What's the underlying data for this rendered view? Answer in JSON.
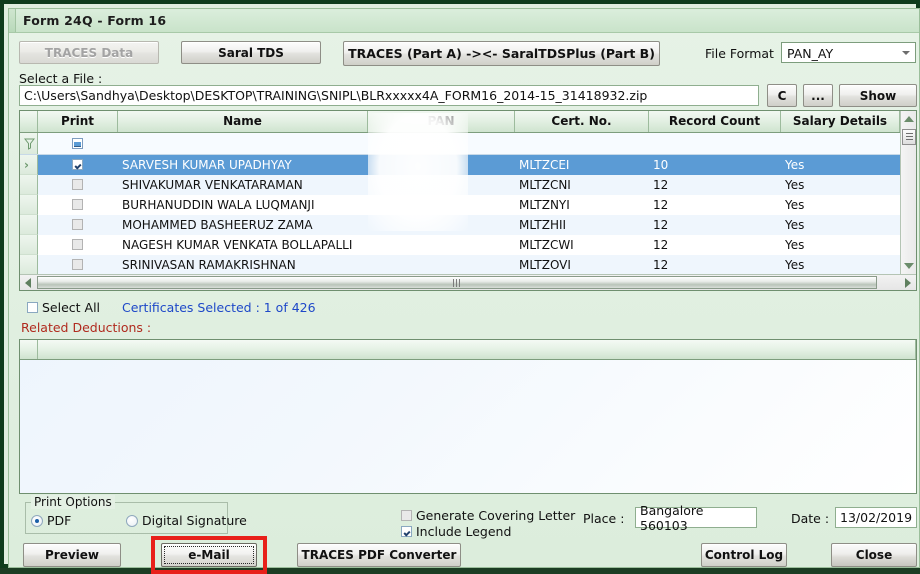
{
  "window": {
    "title": "Form 24Q - Form 16",
    "border_color": "#0e3c1c",
    "background_color": "#dfeedf"
  },
  "toolbar": {
    "traces_data_label": "TRACES Data",
    "saral_tds_label": "Saral TDS",
    "part_ab_label": "TRACES (Part A) -><- SaralTDSPlus (Part B)",
    "file_format_label": "File Format",
    "file_format_value": "PAN_AY",
    "file_format_options": [
      "PAN_AY"
    ]
  },
  "file_row": {
    "select_file_label": "Select a File :",
    "file_path": "C:\\Users\\Sandhya\\Desktop\\DESKTOP\\TRAINING\\SNIPL\\BLRxxxxx4A_FORM16_2014-15_31418932.zip",
    "c_button_label": "C",
    "browse_button_label": "...",
    "show_button_label": "Show"
  },
  "grid": {
    "columns": [
      "Print",
      "Name",
      "PAN",
      "Cert. No.",
      "Record Count",
      "Salary Details"
    ],
    "rows": [
      {
        "print_checked": true,
        "name": "SARVESH KUMAR UPADHYAY",
        "pan": "",
        "cert_no": "MLTZCEI",
        "record_count": "10",
        "salary_details": "Yes",
        "selected": true
      },
      {
        "print_checked": false,
        "name": "SHIVAKUMAR VENKATARAMAN",
        "pan": "",
        "cert_no": "MLTZCNI",
        "record_count": "12",
        "salary_details": "Yes",
        "selected": false
      },
      {
        "print_checked": false,
        "name": "BURHANUDDIN WALA LUQMANJI",
        "pan": "",
        "cert_no": "MLTZNYI",
        "record_count": "12",
        "salary_details": "Yes",
        "selected": false
      },
      {
        "print_checked": false,
        "name": "MOHAMMED BASHEERUZ ZAMA",
        "pan": "",
        "cert_no": "MLTZHII",
        "record_count": "12",
        "salary_details": "Yes",
        "selected": false
      },
      {
        "print_checked": false,
        "name": "NAGESH KUMAR VENKATA BOLLAPALLI",
        "pan": "",
        "cert_no": "MLTZCWI",
        "record_count": "12",
        "salary_details": "Yes",
        "selected": false
      },
      {
        "print_checked": false,
        "name": "SRINIVASAN RAMAKRISHNAN",
        "pan": "",
        "cert_no": "MLTZOVI",
        "record_count": "12",
        "salary_details": "Yes",
        "selected": false
      }
    ],
    "selection_highlight_color": "#5b9bd5"
  },
  "selection": {
    "select_all_label": "Select All",
    "select_all_checked": false,
    "certificates_selected_text": "Certificates Selected :  1 of 426",
    "certificates_selected_color": "#1e48c8"
  },
  "related": {
    "label": "Related Deductions :",
    "label_color": "#b02a1e",
    "rows": []
  },
  "print_options": {
    "group_title": "Print Options",
    "pdf_label": "PDF",
    "pdf_selected": true,
    "digital_signature_label": "Digital Signature",
    "digital_signature_selected": false
  },
  "options": {
    "generate_covering_letter_label": "Generate Covering Letter",
    "generate_covering_letter_checked": false,
    "include_legend_label": "Include Legend",
    "include_legend_checked": true,
    "place_label": "Place :",
    "place_value": "Bangalore 560103",
    "date_label": "Date :",
    "date_value": "13/02/2019"
  },
  "footer": {
    "preview_label": "Preview",
    "email_label": "e-Mail",
    "email_highlight_color": "#e8201a",
    "converter_label": "TRACES PDF Converter",
    "control_log_label": "Control Log",
    "close_label": "Close"
  }
}
